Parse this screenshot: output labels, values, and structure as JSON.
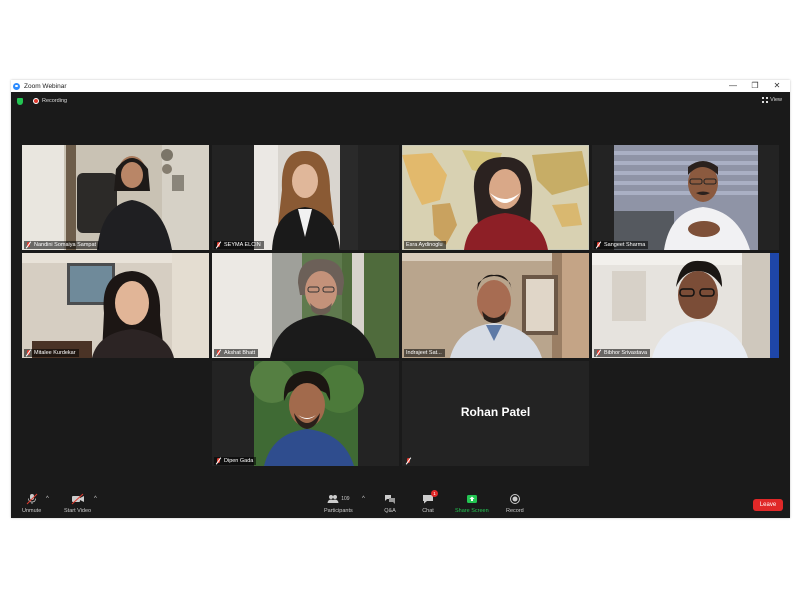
{
  "window": {
    "title": "Zoom Webinar",
    "controls": [
      "—",
      "❐",
      "✕"
    ]
  },
  "topbar": {
    "recording_label": "Recording",
    "view_label": "View"
  },
  "participants": [
    {
      "name": "Nandini Somaiya Sampat"
    },
    {
      "name": "SEYMA ELCIN"
    },
    {
      "name": "Esra Aydinoglu",
      "active_speaker": true
    },
    {
      "name": "Sangeet Sharma"
    },
    {
      "name": "Mitalee Kurdekar"
    },
    {
      "name": "Akshat Bhatt"
    },
    {
      "name": "Indrajeet Sat..."
    },
    {
      "name": "Bibhor Srivastava"
    },
    {
      "name": "Dipen Gada"
    },
    {
      "name": "Rohan Patel",
      "video_off": true
    }
  ],
  "controls": {
    "unmute": "Unmute",
    "start_video": "Start Video",
    "participants": "Participants",
    "participants_count": "109",
    "qa": "Q&A",
    "chat": "Chat",
    "chat_badge": "1",
    "share_screen": "Share Screen",
    "record": "Record",
    "leave": "Leave"
  },
  "colors": {
    "active_speaker_border": "#b8cf3a",
    "share_green": "#23c552",
    "leave_red": "#e02828",
    "background": "#1a1a1a"
  }
}
